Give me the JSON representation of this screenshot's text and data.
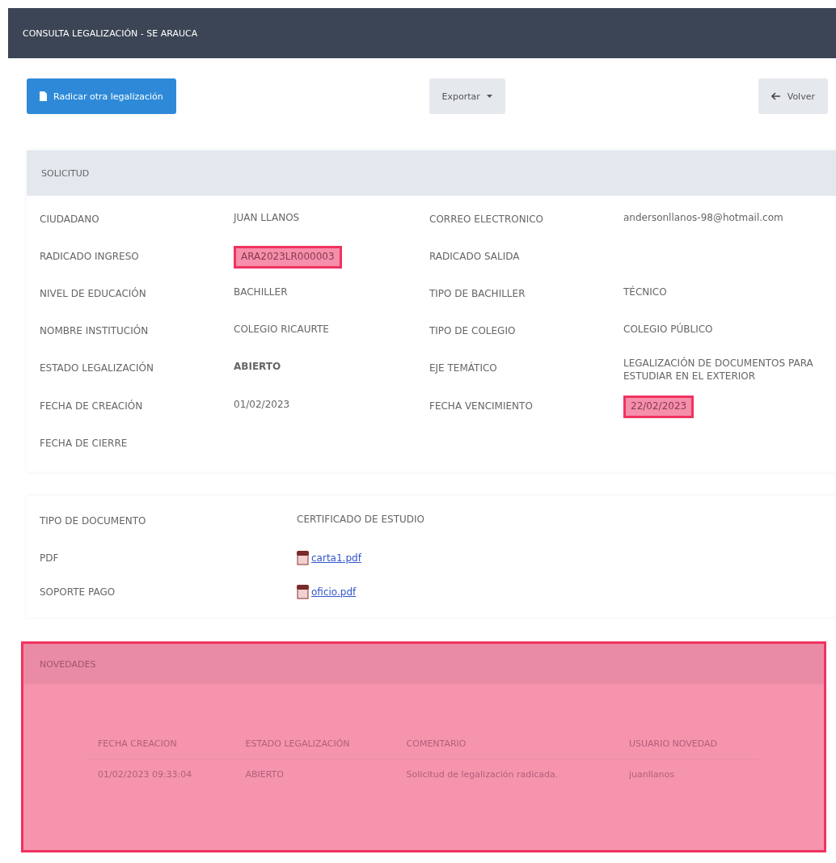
{
  "header": {
    "title": "CONSULTA LEGALIZACIÓN - SE ARAUCA"
  },
  "toolbar": {
    "primary": "Radicar otra legalización",
    "export": "Exportar",
    "back": "Volver"
  },
  "solicitud": {
    "title": "SOLICITUD",
    "fields": [
      {
        "label": "CIUDADANO",
        "value": "JUAN LLANOS"
      },
      {
        "label": "CORREO ELECTRONICO",
        "value": "andersonllanos-98@hotmail.com"
      },
      {
        "label": "RADICADO INGRESO",
        "value": "ARA2023LR000003",
        "highlighted": true
      },
      {
        "label": "RADICADO SALIDA"
      },
      {
        "label": "NIVEL DE EDUCACIÓN",
        "value": "BACHILLER"
      },
      {
        "label": "TIPO DE BACHILLER",
        "value": "TÉCNICO"
      },
      {
        "label": "NOMBRE INSTITUCIÓN",
        "value": "COLEGIO RICAURTE"
      },
      {
        "label": "TIPO DE COLEGIO",
        "value": "COLEGIO PÚBLICO"
      },
      {
        "label": "ESTADO LEGALIZACIÓN",
        "value": "ABIERTO",
        "bold": true
      },
      {
        "label": "EJE TEMÁTICO",
        "value": "LEGALIZACIÓN DE DOCUMENTOS PARA ESTUDIAR EN EL EXTERIOR"
      },
      {
        "label": "FECHA DE CREACIÓN",
        "value": "01/02/2023"
      },
      {
        "label": "FECHA VENCIMIENTO",
        "value": "22/02/2023",
        "highlighted": true
      },
      {
        "label": "FECHA DE CIERRE"
      }
    ]
  },
  "documento": {
    "rows": [
      {
        "label": "TIPO DE DOCUMENTO",
        "kind": "text",
        "value": "CERTIFICADO DE ESTUDIO"
      },
      {
        "label": "PDF",
        "kind": "file",
        "value": "carta1.pdf"
      },
      {
        "label": "SOPORTE PAGO",
        "kind": "file",
        "value": "oficio.pdf"
      }
    ]
  },
  "novedades": {
    "title": "NOVEDADES",
    "highlighted": true,
    "columns": [
      "FECHA CREACION",
      "ESTADO LEGALIZACIÓN",
      "COMENTARIO",
      "USUARIO NOVEDAD"
    ],
    "rows": [
      [
        "01/02/2023 09:33:04",
        "ABIERTO",
        "Solicitud de legalización radicada.",
        "juanllanos"
      ]
    ]
  }
}
